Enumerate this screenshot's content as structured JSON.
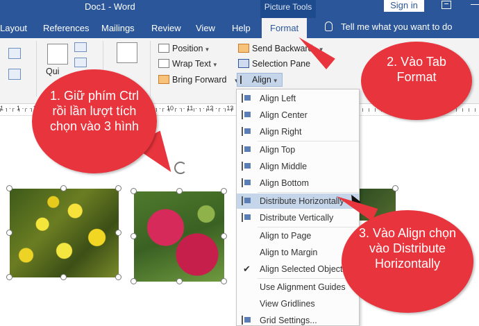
{
  "titlebar": {
    "document_title": "Doc1 - Word",
    "context_group": "Picture Tools",
    "signin_label": "Sign in"
  },
  "tabs": [
    {
      "label": "Layout"
    },
    {
      "label": "References"
    },
    {
      "label": "Mailings"
    },
    {
      "label": "Review"
    },
    {
      "label": "View"
    },
    {
      "label": "Help"
    },
    {
      "label": "Format",
      "active": true
    }
  ],
  "tell_me": "Tell me what you want to do",
  "ribbon": {
    "quick_label": "Qui",
    "position_label": "Position",
    "wrap_text_label": "Wrap Text",
    "bring_forward_label": "Bring Forward",
    "send_backward_label": "Send Backward",
    "selection_pane_label": "Selection Pane",
    "align_label": "Align"
  },
  "ruler_text": "1 · · · 1 · · · 2 · · · 3 · · · 4 · · · 5 · · · 6 · · · 7 · · · 8 · · · 9 · · · 10 · · · 11 · · · 12 · · · 13 · · · 14 · · · 15",
  "align_menu": {
    "items": [
      {
        "label": "Align Left",
        "icon": "align-left-icon"
      },
      {
        "label": "Align Center",
        "icon": "align-center-icon"
      },
      {
        "label": "Align Right",
        "icon": "align-right-icon"
      },
      {
        "label": "Align Top",
        "icon": "align-top-icon"
      },
      {
        "label": "Align Middle",
        "icon": "align-middle-icon"
      },
      {
        "label": "Align Bottom",
        "icon": "align-bottom-icon"
      },
      {
        "label": "Distribute Horizontally",
        "icon": "distribute-horizontally-icon",
        "highlighted": true
      },
      {
        "label": "Distribute Vertically",
        "icon": "distribute-vertically-icon"
      },
      {
        "label": "Align to Page"
      },
      {
        "label": "Align to Margin"
      },
      {
        "label": "Align Selected Objects",
        "checked": true
      },
      {
        "label": "Use Alignment Guides"
      },
      {
        "label": "View Gridlines"
      },
      {
        "label": "Grid Settings...",
        "icon": "grid-icon"
      }
    ]
  },
  "callouts": {
    "step1": "1. Giữ phím Ctrl rồi lần lượt tích chọn vào 3 hình",
    "step2": "2. Vào Tab Format",
    "step3": "3. Vào Align chọn vào Distribute Horizontally"
  },
  "colors": {
    "word_blue": "#2b579a",
    "callout_red": "#e8343c",
    "menu_highlight": "#c5d5ea"
  }
}
